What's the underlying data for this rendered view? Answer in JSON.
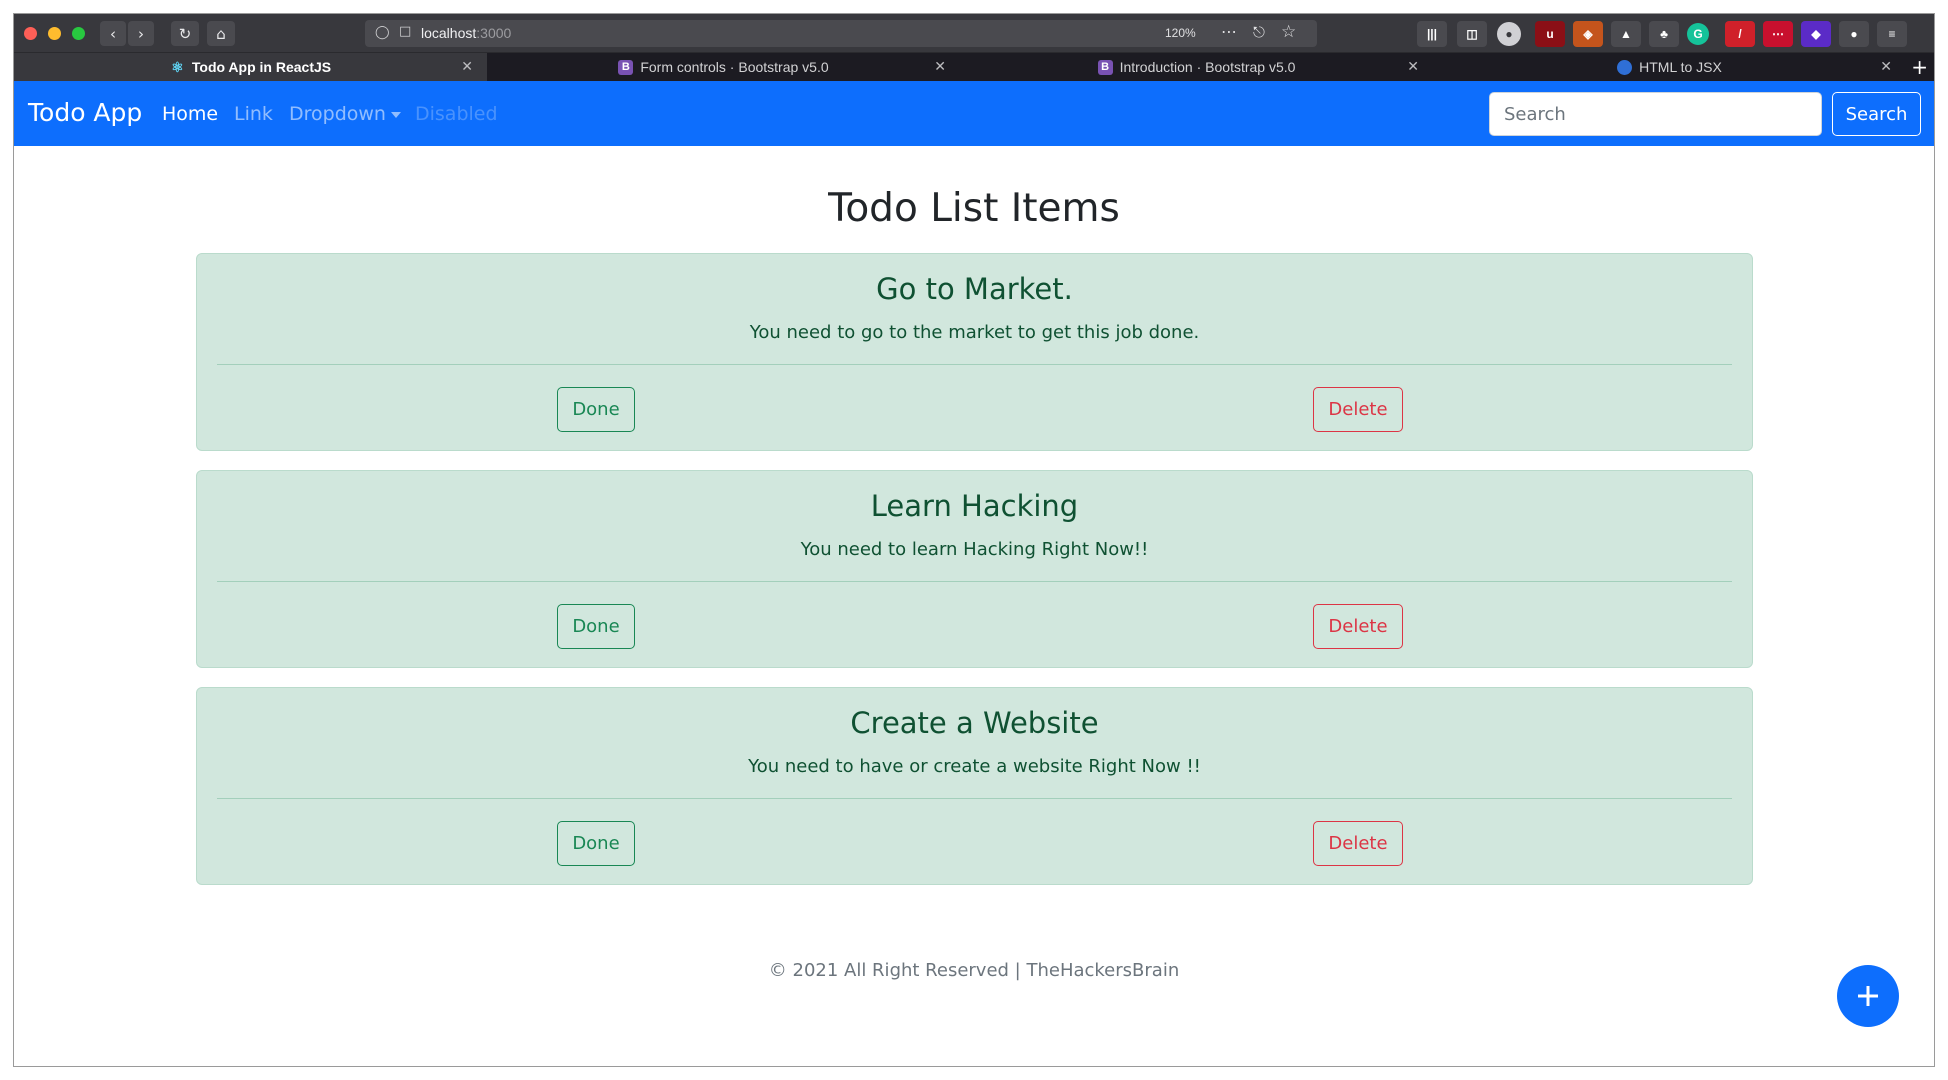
{
  "browser": {
    "url_host": "localhost",
    "url_port": ":3000",
    "zoom": "120%",
    "tabs": [
      {
        "title": "Todo App in ReactJS",
        "active": true
      },
      {
        "title": "Form controls · Bootstrap v5.0",
        "active": false
      },
      {
        "title": "Introduction · Bootstrap v5.0",
        "active": false
      },
      {
        "title": "HTML to JSX",
        "active": false
      }
    ],
    "icons": [
      "back-icon",
      "forward-icon",
      "reload-icon",
      "home-icon",
      "shield-icon",
      "page-icon",
      "more-icon",
      "pocket-icon",
      "star-icon",
      "library-icon",
      "sidebar-icon",
      "account-icon",
      "menu-icon",
      "close-icon",
      "new-tab-icon"
    ]
  },
  "navbar": {
    "brand": "Todo App",
    "links": [
      {
        "label": "Home",
        "state": "active"
      },
      {
        "label": "Link",
        "state": "normal"
      },
      {
        "label": "Dropdown",
        "state": "dropdown"
      },
      {
        "label": "Disabled",
        "state": "disabled"
      }
    ],
    "search_placeholder": "Search",
    "search_button": "Search"
  },
  "main": {
    "title": "Todo List Items",
    "todos": [
      {
        "title": "Go to Market.",
        "description": "You need to go to the market to get this job done.",
        "done_label": "Done",
        "delete_label": "Delete"
      },
      {
        "title": "Learn Hacking",
        "description": "You need to learn Hacking Right Now!!",
        "done_label": "Done",
        "delete_label": "Delete"
      },
      {
        "title": "Create a Website",
        "description": "You need to have or create a website Right Now !!",
        "done_label": "Done",
        "delete_label": "Delete"
      }
    ]
  },
  "footer": {
    "text": "© 2021 All Right Reserved | TheHackersBrain"
  },
  "colors": {
    "primary": "#0d6efd",
    "success": "#198754",
    "danger": "#dc3545",
    "card_bg": "#d1e7dd",
    "card_text": "#0f5132"
  }
}
